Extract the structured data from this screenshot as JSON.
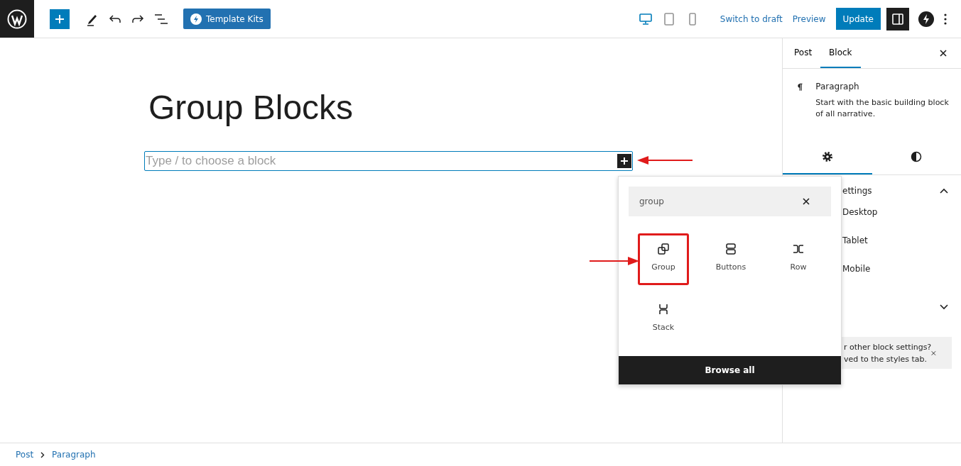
{
  "toolbar": {
    "template_button": "Template Kits",
    "devices": [
      {
        "kind": "desktop",
        "selected": true
      },
      {
        "kind": "tablet",
        "selected": false
      },
      {
        "kind": "mobile",
        "selected": false
      }
    ],
    "switch_link": "Switch to draft",
    "preview_link": "Preview",
    "update_button": "Update",
    "settings_toggle_on": true
  },
  "editor": {
    "title": "Group Blocks",
    "block_placeholder": "Type / to choose a block"
  },
  "inserter": {
    "search_value": "group",
    "results": [
      {
        "kind": "group",
        "label": "Group",
        "highlighted": true
      },
      {
        "kind": "buttons",
        "label": "Buttons",
        "highlighted": false
      },
      {
        "kind": "row",
        "label": "Row",
        "highlighted": false
      },
      {
        "kind": "stack",
        "label": "Stack",
        "highlighted": false
      }
    ],
    "browse_all": "Browse all"
  },
  "sidebar": {
    "tabs": [
      {
        "label": "Post",
        "selected": false
      },
      {
        "label": "Block",
        "selected": true
      }
    ],
    "block_card": {
      "title": "Paragraph",
      "description": "Start with the basic building block of all narrative."
    },
    "inspector_tabs": [
      {
        "kind": "settings",
        "selected": true
      },
      {
        "kind": "styles",
        "selected": false
      }
    ],
    "panels": [
      {
        "title": "ettings",
        "expanded": true,
        "options": [
          "Desktop",
          "Tablet",
          "Mobile"
        ]
      },
      {
        "expanded": false
      }
    ],
    "notice": {
      "lines": [
        "r other block settings?",
        "ved to the styles tab."
      ]
    }
  },
  "breadcrumbs": [
    "Post",
    "Paragraph"
  ]
}
